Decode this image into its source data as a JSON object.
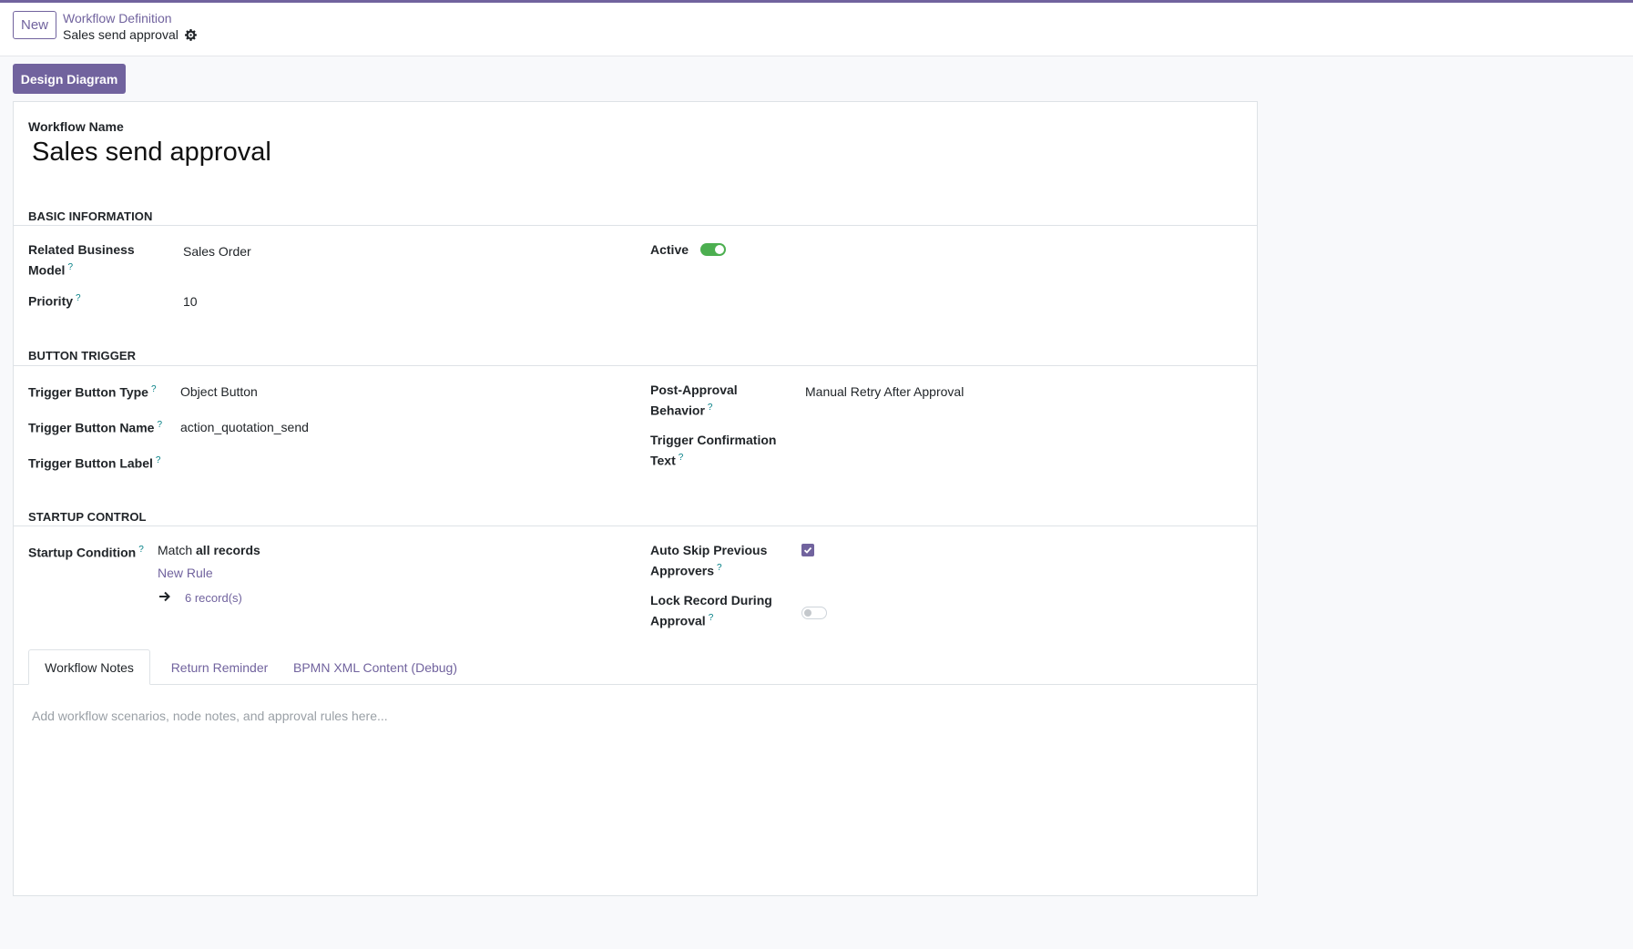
{
  "header": {
    "new_button": "New",
    "breadcrumb_parent": "Workflow Definition",
    "breadcrumb_current": "Sales send approval"
  },
  "toolbar": {
    "design_diagram": "Design Diagram"
  },
  "form": {
    "name_label": "Workflow Name",
    "name_value": "Sales send approval",
    "basic": {
      "title": "BASIC INFORMATION",
      "related_model_label_1": "Related Business",
      "related_model_label_2": "Model",
      "related_model_value": "Sales Order",
      "priority_label": "Priority",
      "priority_value": "10",
      "active_label": "Active",
      "active_value": true
    },
    "trigger": {
      "title": "BUTTON TRIGGER",
      "type_label": "Trigger Button Type",
      "type_value": "Object Button",
      "name_label": "Trigger Button Name",
      "name_value": "action_quotation_send",
      "label_label": "Trigger Button Label",
      "label_value": "",
      "post_label_1": "Post-Approval",
      "post_label_2": "Behavior",
      "post_value": "Manual Retry After Approval",
      "confirm_label_1": "Trigger Confirmation",
      "confirm_label_2": "Text",
      "confirm_value": ""
    },
    "startup": {
      "title": "STARTUP CONTROL",
      "condition_label": "Startup Condition",
      "match_prefix": "Match ",
      "match_bold": "all records",
      "new_rule": "New Rule",
      "records": "6 record(s)",
      "auto_skip_label_1": "Auto Skip Previous",
      "auto_skip_label_2": "Approvers",
      "auto_skip_value": true,
      "lock_label_1": "Lock Record During",
      "lock_label_2": "Approval",
      "lock_value": false
    },
    "tabs": [
      {
        "label": "Workflow Notes",
        "active": true
      },
      {
        "label": "Return Reminder",
        "active": false
      },
      {
        "label": "BPMN XML Content (Debug)",
        "active": false
      }
    ],
    "notes_placeholder": "Add workflow scenarios, node notes, and approval rules here..."
  },
  "help_marker": "?",
  "colors": {
    "accent": "#71639e",
    "toggle_on": "#4caf50"
  }
}
